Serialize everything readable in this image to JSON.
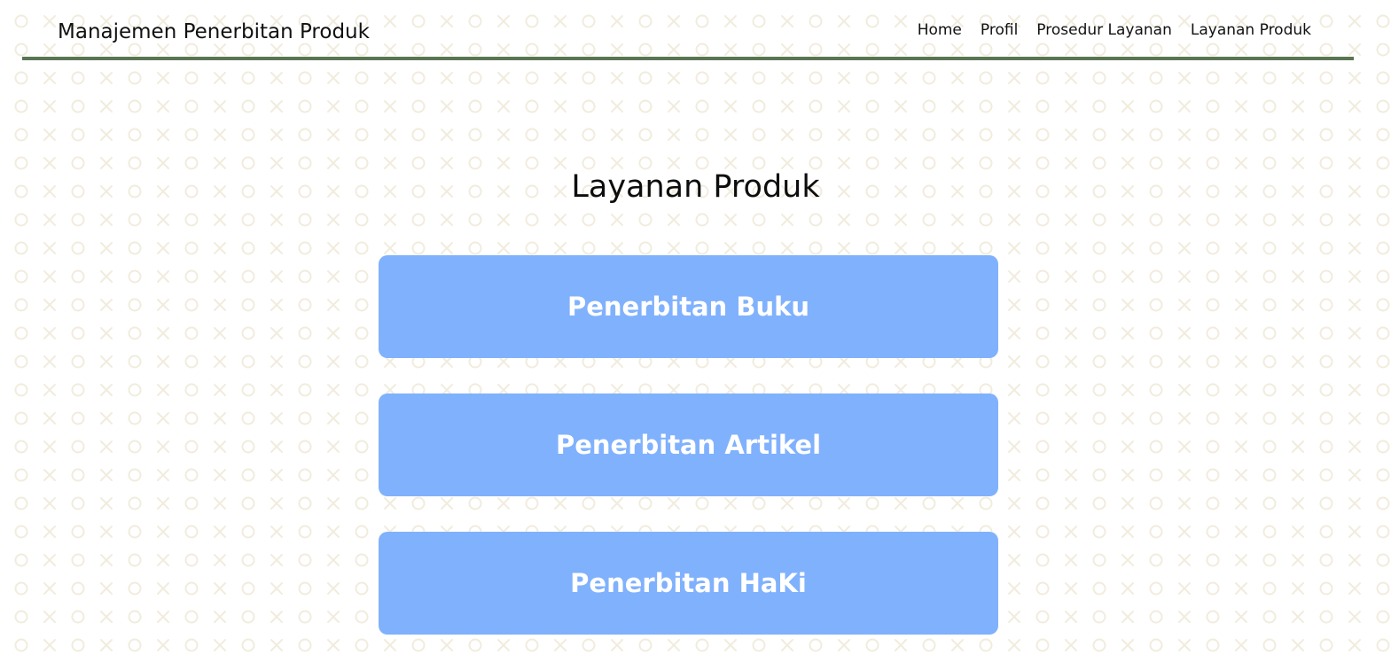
{
  "header": {
    "brand": "Manajemen Penerbitan Produk",
    "nav": [
      {
        "label": "Home"
      },
      {
        "label": "Profil"
      },
      {
        "label": "Prosedur Layanan"
      },
      {
        "label": "Layanan Produk"
      }
    ]
  },
  "main": {
    "title": "Layanan Produk",
    "services": [
      {
        "label": "Penerbitan Buku"
      },
      {
        "label": "Penerbitan Artikel"
      },
      {
        "label": "Penerbitan HaKi"
      }
    ]
  },
  "colors": {
    "accent": "#80b1fd",
    "navbar_border": "#5a7553",
    "pattern": "#f1ecdd"
  }
}
